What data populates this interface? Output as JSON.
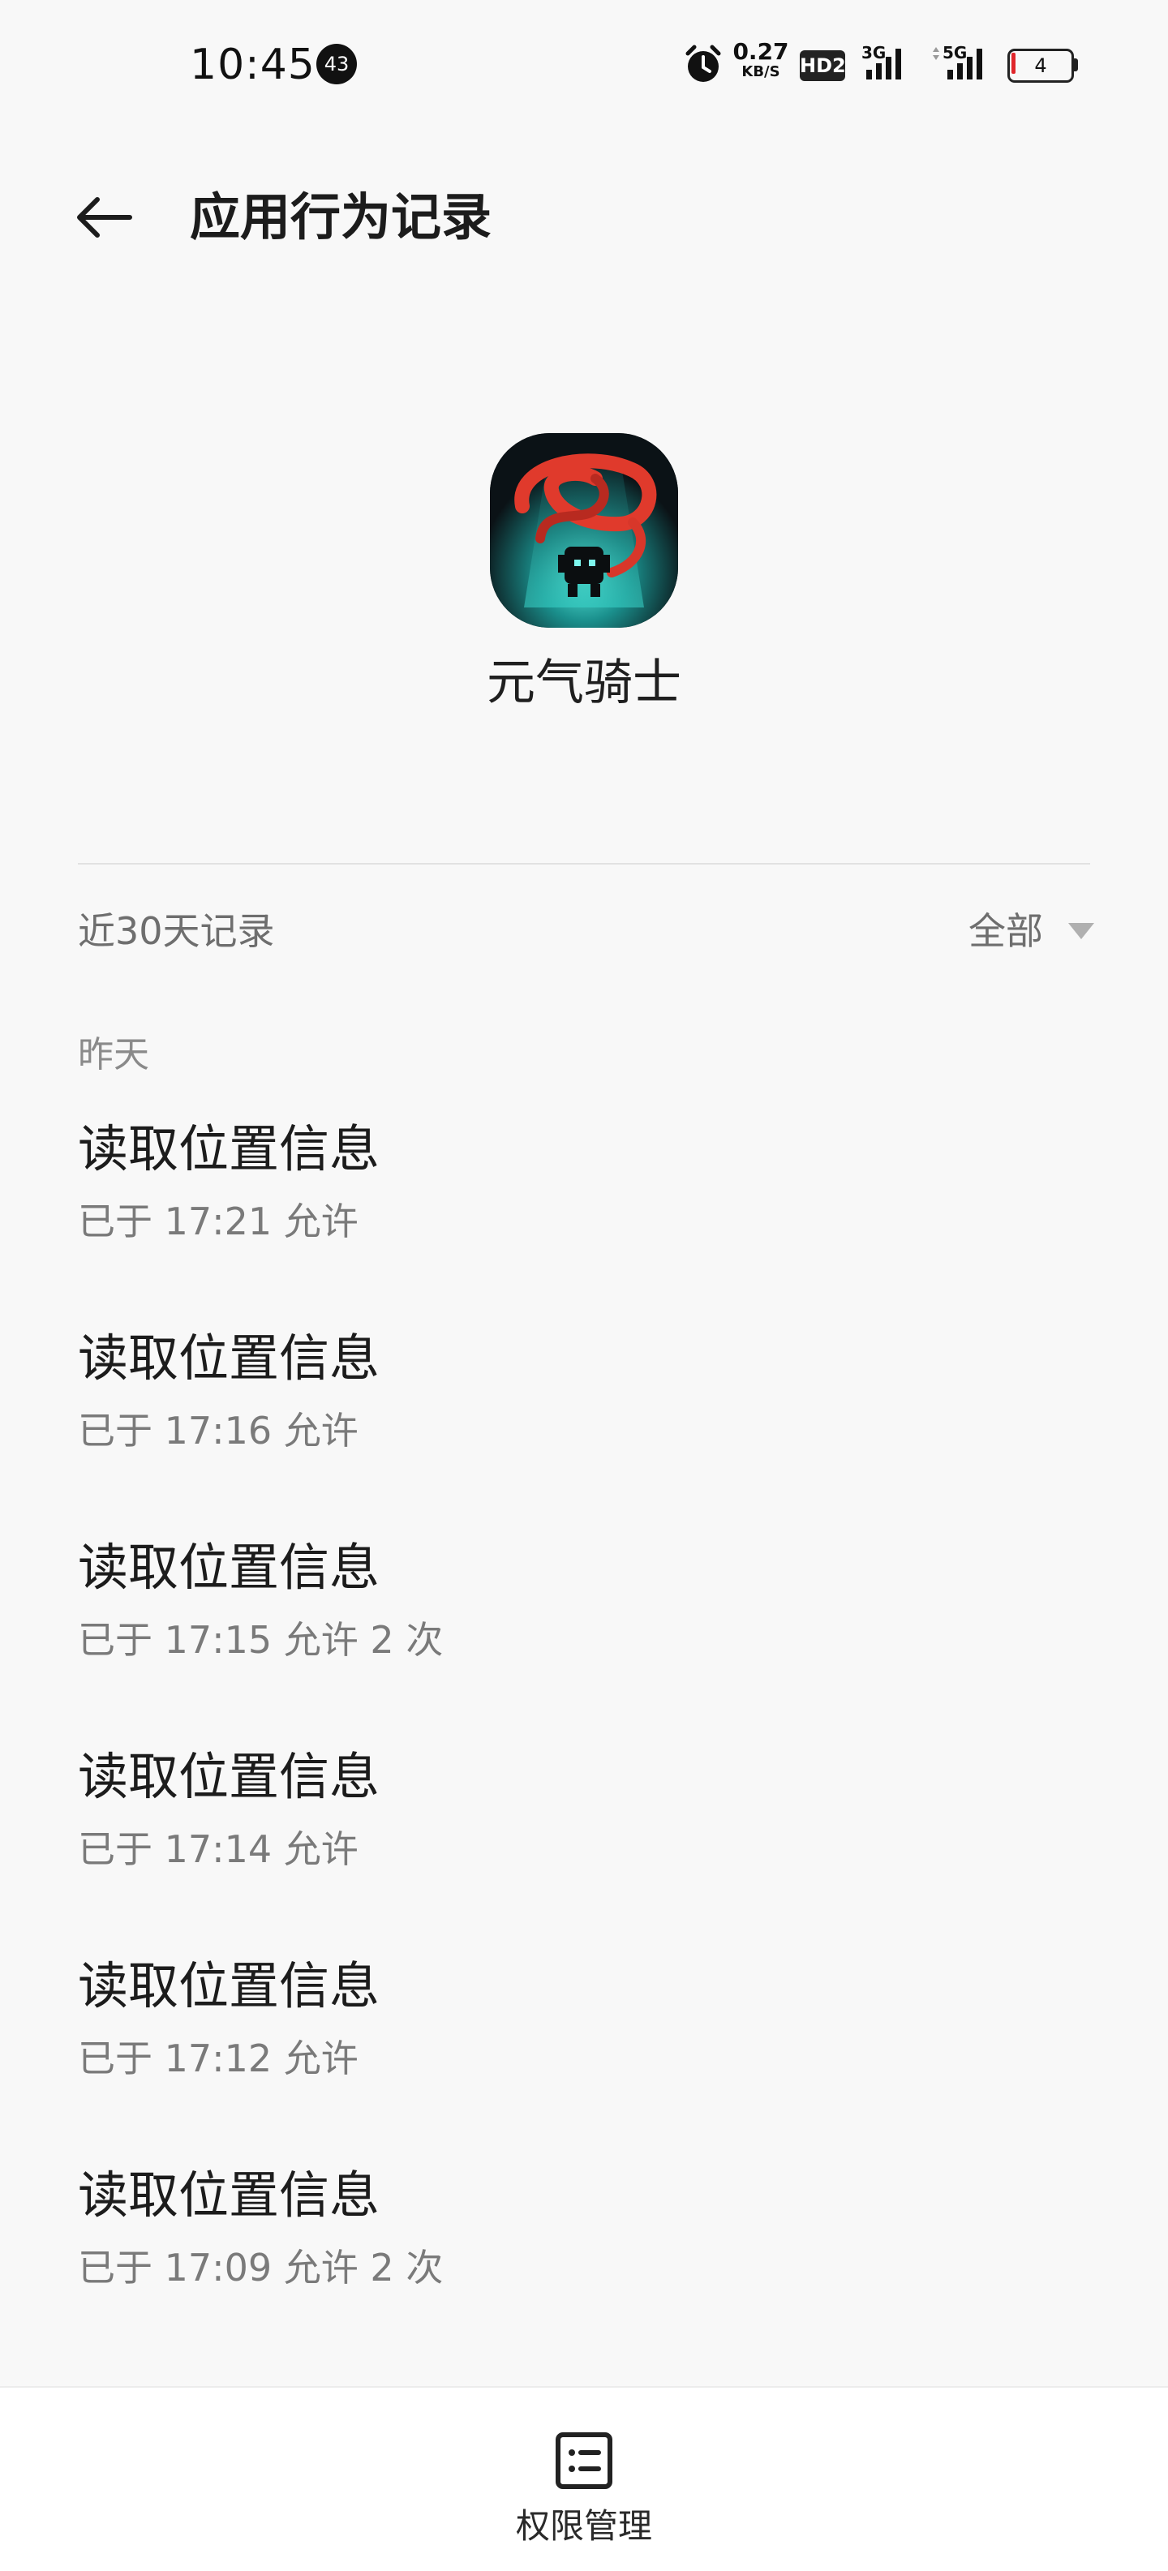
{
  "status_bar": {
    "time": "10:45",
    "notification_count": "43",
    "network_speed_value": "0.27",
    "network_speed_unit": "KB/S",
    "hd_label": "HD2",
    "signal1_label": "3G",
    "signal2_label": "5G",
    "battery_level": "4",
    "battery_color": "#e0262b"
  },
  "header": {
    "title": "应用行为记录",
    "back_icon": "arrow-left-icon"
  },
  "app": {
    "name": "元气骑士",
    "icon": "soul-knight-app-icon"
  },
  "filter": {
    "section_label": "近30天记录",
    "selected": "全部",
    "dropdown_icon": "triangle-down-icon"
  },
  "groups": [
    {
      "label": "昨天",
      "records": [
        {
          "title": "读取位置信息",
          "detail": "已于 17:21 允许"
        },
        {
          "title": "读取位置信息",
          "detail": "已于 17:16 允许"
        },
        {
          "title": "读取位置信息",
          "detail": "已于 17:15 允许 2 次"
        },
        {
          "title": "读取位置信息",
          "detail": "已于 17:14 允许"
        },
        {
          "title": "读取位置信息",
          "detail": "已于 17:12 允许"
        },
        {
          "title": "读取位置信息",
          "detail": "已于 17:09 允许 2 次"
        }
      ]
    }
  ],
  "bottom_bar": {
    "permission_label": "权限管理",
    "permission_icon": "list-icon"
  }
}
